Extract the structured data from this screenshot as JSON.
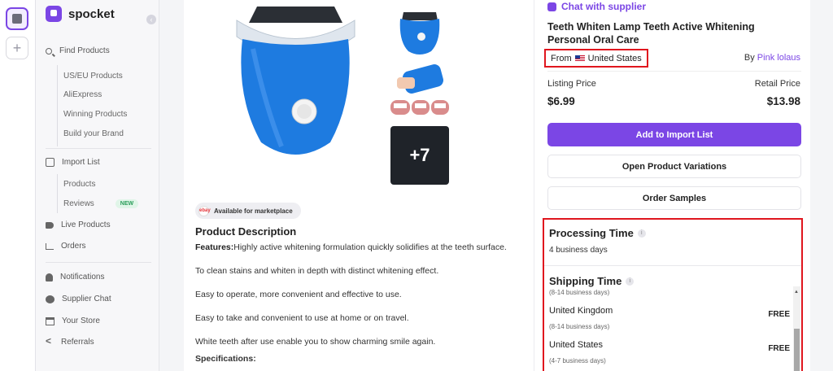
{
  "app": {
    "name": "spocket"
  },
  "sidebar": {
    "collapse_glyph": "‹",
    "find_products": {
      "label": "Find Products",
      "icon": "search-icon"
    },
    "find_sub": [
      "US/EU Products",
      "AliExpress",
      "Winning Products",
      "Build your Brand"
    ],
    "import_list": {
      "label": "Import List",
      "icon": "import-list-icon"
    },
    "import_sub": [
      {
        "label": "Products"
      },
      {
        "label": "Reviews",
        "badge": "NEW"
      }
    ],
    "live_products": {
      "label": "Live Products",
      "icon": "tag-icon"
    },
    "orders": {
      "label": "Orders",
      "icon": "cart-icon"
    },
    "notifications": {
      "label": "Notifications",
      "icon": "bell-icon"
    },
    "supplier_chat": {
      "label": "Supplier Chat",
      "icon": "chat-icon"
    },
    "your_store": {
      "label": "Your Store",
      "icon": "store-icon"
    },
    "referrals": {
      "label": "Referrals",
      "icon": "share-icon"
    }
  },
  "gallery": {
    "more_count": "+7"
  },
  "marketplace": {
    "label": "Available for marketplace",
    "logo": "ebay"
  },
  "description": {
    "title": "Product Description",
    "features_label": "Features:",
    "features_text": "Highly active whitening formulation quickly solidifies at the teeth surface.",
    "lines": [
      "To clean stains and whiten in depth with distinct whitening effect.",
      "Easy to operate, more convenient and effective to use.",
      "Easy to take and convenient to use at home or on travel.",
      "White teeth after use enable you to show charming smile again."
    ],
    "specs_label": "Specifications:"
  },
  "product": {
    "chat_label": "Chat with supplier",
    "title": "Teeth Whiten Lamp Teeth Active Whitening Personal Oral Care",
    "from_label": "From",
    "origin": "United States",
    "by_label": "By",
    "supplier": "Pink lolaus",
    "listing_price_label": "Listing Price",
    "listing_price": "$6.99",
    "retail_price_label": "Retail Price",
    "retail_price": "$13.98",
    "add_button": "Add to Import List",
    "variations_button": "Open Product Variations",
    "samples_button": "Order Samples"
  },
  "shipping": {
    "processing_title": "Processing Time",
    "processing_value": "4 business days",
    "shipping_title": "Shipping Time",
    "shipping_range": "(8-14 business days)",
    "rows": [
      {
        "country": "United Kingdom",
        "cost": "FREE",
        "days": "(8-14 business days)"
      },
      {
        "country": "United States",
        "cost": "FREE",
        "days": "(4-7 business days)"
      }
    ]
  },
  "colors": {
    "accent": "#7b46e5",
    "highlight": "#e0161e",
    "product_blue": "#1e7be0"
  }
}
